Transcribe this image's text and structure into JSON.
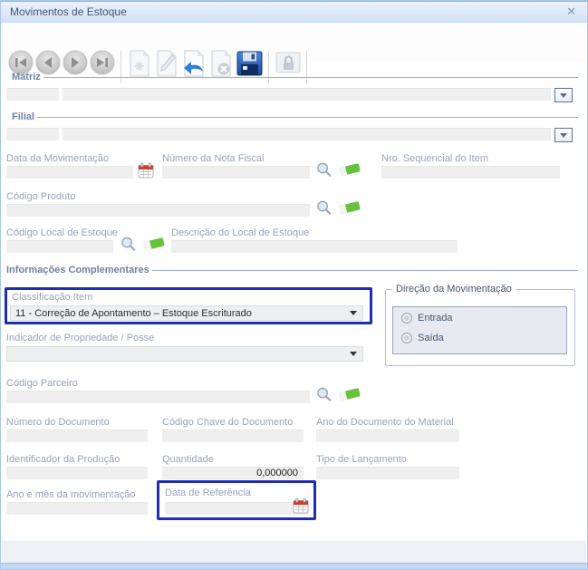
{
  "window": {
    "title": "Movimentos de Estoque",
    "close": "✕"
  },
  "toolbar": {
    "buttons": [
      {
        "name": "first-record"
      },
      {
        "name": "previous-record"
      },
      {
        "name": "next-record"
      },
      {
        "name": "last-record"
      },
      {
        "name": "new"
      },
      {
        "name": "edit"
      },
      {
        "name": "undo"
      },
      {
        "name": "cancel"
      },
      {
        "name": "save"
      },
      {
        "name": "lock"
      }
    ]
  },
  "sections": {
    "matriz": {
      "label": "Matriz"
    },
    "filial": {
      "label": "Filial"
    },
    "info_complementares": {
      "label": "Informações Complementares"
    }
  },
  "fields": {
    "matriz_codigo": {
      "value": ""
    },
    "matriz_descricao": {
      "value": ""
    },
    "filial_codigo": {
      "value": ""
    },
    "filial_descricao": {
      "value": ""
    },
    "data_movimentacao": {
      "label": "Data da Movimentação",
      "value": ""
    },
    "numero_nota_fiscal": {
      "label": "Número da Nota Fiscal",
      "value": ""
    },
    "nro_sequencial_item": {
      "label": "Nro. Sequencial do Item",
      "value": ""
    },
    "codigo_produto": {
      "label": "Código Produto",
      "value": ""
    },
    "codigo_local_estoque": {
      "label": "Código Local de Estoque",
      "value": ""
    },
    "descricao_local_estoque": {
      "label": "Descrição do Local de Estoque",
      "value": ""
    },
    "classificacao_item": {
      "label": "Classificação Item",
      "value": "11 - Correção de Apontamento – Estoque Escriturado"
    },
    "indicador_propriedade": {
      "label": "Indicador de Propriedade / Posse",
      "value": ""
    },
    "codigo_parceiro": {
      "label": "Código Parceiro",
      "value": ""
    },
    "numero_documento": {
      "label": "Número do Documento",
      "value": ""
    },
    "codigo_chave_documento": {
      "label": "Código Chave do Documento",
      "value": ""
    },
    "ano_documento_material": {
      "label": "Ano do Documento do Material",
      "value": ""
    },
    "identificador_producao": {
      "label": "Identificador da Produção",
      "value": ""
    },
    "quantidade": {
      "label": "Quantidade",
      "value": "0,000000"
    },
    "tipo_lancamento": {
      "label": "Tipo de Lançamento",
      "value": ""
    },
    "ano_mes_movimentacao": {
      "label": "Ano e mês da movimentação",
      "value": ""
    },
    "data_referencia": {
      "label": "Data de Referência",
      "value": ""
    }
  },
  "direcao": {
    "legend": "Direção da Movimentação",
    "options": [
      {
        "label": "Entrada",
        "selected": false
      },
      {
        "label": "Saída",
        "selected": false
      }
    ]
  },
  "colors": {
    "highlight_box": "#1e2db2",
    "title_text": "#44546e",
    "field_bg": "#efefef",
    "label_text": "#97a3b9",
    "accent_blue": "#2f7dd8",
    "eraser_green": "#66c23c",
    "calendar_red": "#d33a2f"
  }
}
